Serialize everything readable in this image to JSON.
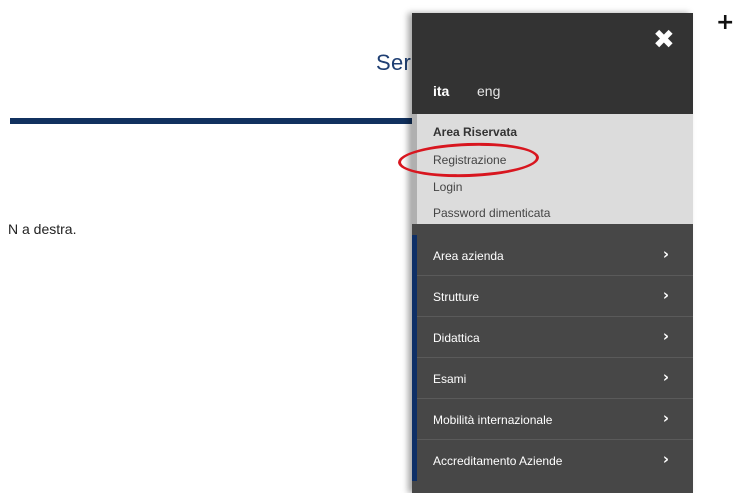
{
  "background": {
    "title": "Ser",
    "instruction_fragment": "N a destra.",
    "plus_symbol": "+"
  },
  "menu": {
    "close_symbol": "✖",
    "languages": [
      {
        "label": "ita",
        "active": true
      },
      {
        "label": "eng",
        "active": false
      }
    ],
    "reserved_area": {
      "heading": "Area Riservata",
      "items": [
        "Registrazione",
        "Login",
        "Password dimenticata"
      ],
      "highlighted_item": "Registrazione"
    },
    "nav_items": [
      {
        "label": "Area azienda"
      },
      {
        "label": "Strutture"
      },
      {
        "label": "Didattica"
      },
      {
        "label": "Esami"
      },
      {
        "label": "Mobilità internazionale"
      },
      {
        "label": "Accreditamento Aziende"
      }
    ],
    "chevron_symbol": "›"
  },
  "colors": {
    "menu_bg": "#474747",
    "menu_top_bg": "#333333",
    "reserved_bg": "#dcdcdc",
    "nav_accent": "#0e2f66",
    "highlight": "#d8161f",
    "title_blue": "#1f3f73"
  }
}
